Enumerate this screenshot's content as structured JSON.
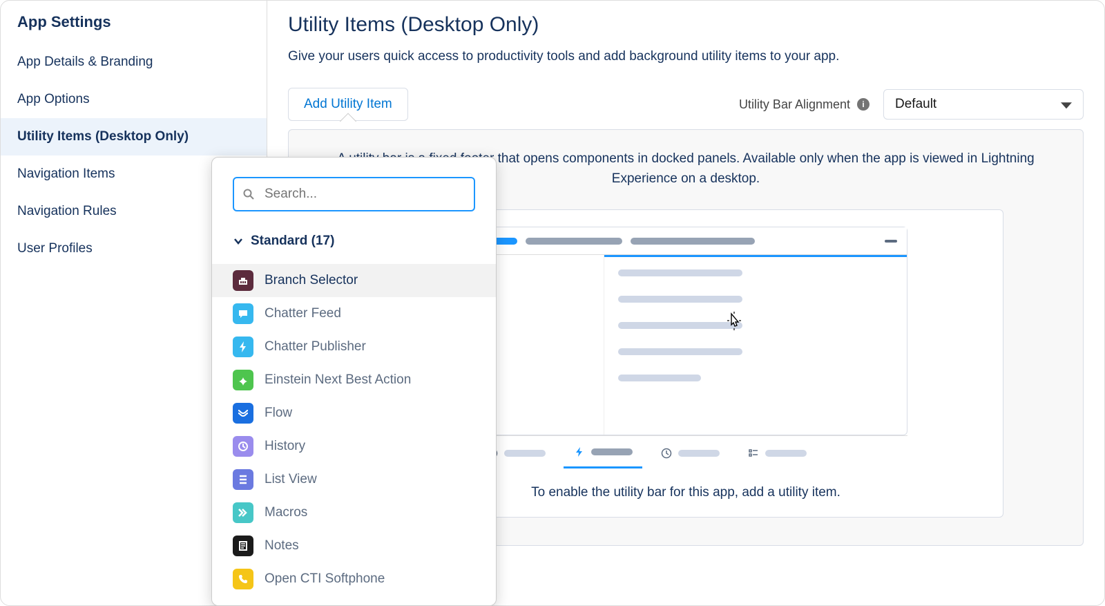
{
  "sidebar": {
    "heading": "App Settings",
    "items": [
      {
        "label": "App Details & Branding"
      },
      {
        "label": "App Options"
      },
      {
        "label": "Utility Items (Desktop Only)",
        "active": true
      },
      {
        "label": "Navigation Items"
      },
      {
        "label": "Navigation Rules"
      },
      {
        "label": "User Profiles"
      }
    ]
  },
  "main": {
    "title": "Utility Items (Desktop Only)",
    "subtitle": "Give your users quick access to productivity tools and add background utility items to your app.",
    "add_button": "Add Utility Item",
    "alignment_label": "Utility Bar Alignment",
    "alignment_value": "Default",
    "panel_description": "A utility bar is a fixed footer that opens components in docked panels. Available only when the app is viewed in Lightning Experience on a desktop.",
    "enable_text": "To enable the utility bar for this app, add a utility item."
  },
  "dropdown": {
    "search_placeholder": "Search...",
    "section_label": "Standard (17)",
    "items": [
      {
        "label": "Branch Selector",
        "icon": "branch",
        "hover": true
      },
      {
        "label": "Chatter Feed",
        "icon": "chatter"
      },
      {
        "label": "Chatter Publisher",
        "icon": "publisher"
      },
      {
        "label": "Einstein Next Best Action",
        "icon": "einstein"
      },
      {
        "label": "Flow",
        "icon": "flow"
      },
      {
        "label": "History",
        "icon": "history"
      },
      {
        "label": "List View",
        "icon": "listview"
      },
      {
        "label": "Macros",
        "icon": "macros"
      },
      {
        "label": "Notes",
        "icon": "notes"
      },
      {
        "label": "Open CTI Softphone",
        "icon": "phone"
      }
    ]
  }
}
